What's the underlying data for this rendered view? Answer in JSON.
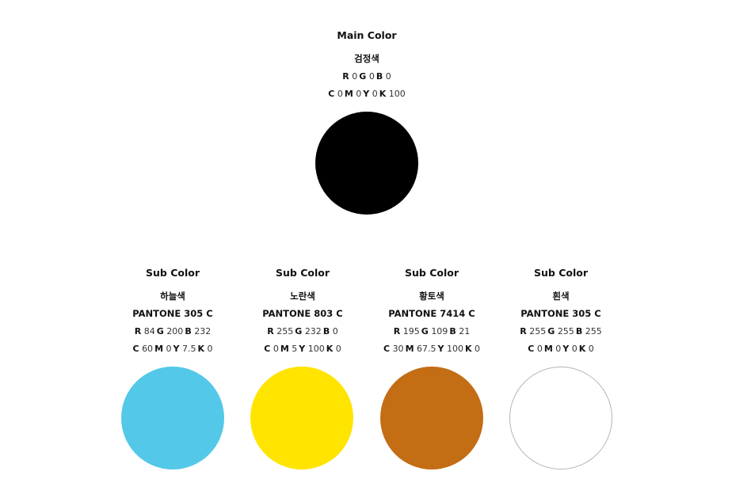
{
  "main": {
    "heading": "Main Color",
    "name": "검정색",
    "rgb": {
      "R": "0",
      "G": "0",
      "B": "0"
    },
    "cmyk": {
      "C": "0",
      "M": "0",
      "Y": "0",
      "K": "100"
    },
    "swatch_color": "#000000"
  },
  "subs": [
    {
      "heading": "Sub Color",
      "name": "하늘색",
      "pantone": "PANTONE 305 C",
      "rgb": {
        "R": "84",
        "G": "200",
        "B": "232"
      },
      "cmyk": {
        "C": "60",
        "M": "0",
        "Y": "7.5",
        "K": "0"
      },
      "swatch_color": "#54C8E8"
    },
    {
      "heading": "Sub Color",
      "name": "노란색",
      "pantone": "PANTONE 803 C",
      "rgb": {
        "R": "255",
        "G": "232",
        "B": "0"
      },
      "cmyk": {
        "C": "0",
        "M": "5",
        "Y": "100",
        "K": "0"
      },
      "swatch_color": "#FFE400"
    },
    {
      "heading": "Sub Color",
      "name": "황토색",
      "pantone": "PANTONE 7414 C",
      "rgb": {
        "R": "195",
        "G": "109",
        "B": "21"
      },
      "cmyk": {
        "C": "30",
        "M": "67.5",
        "Y": "100",
        "K": "0"
      },
      "swatch_color": "#C36D15"
    },
    {
      "heading": "Sub Color",
      "name": "흰색",
      "pantone": "PANTONE 305 C",
      "rgb": {
        "R": "255",
        "G": "255",
        "B": "255"
      },
      "cmyk": {
        "C": "0",
        "M": "0",
        "Y": "0",
        "K": "0"
      },
      "swatch_color": "#FFFFFF",
      "swatch_border": "#B5B5B5"
    }
  ]
}
